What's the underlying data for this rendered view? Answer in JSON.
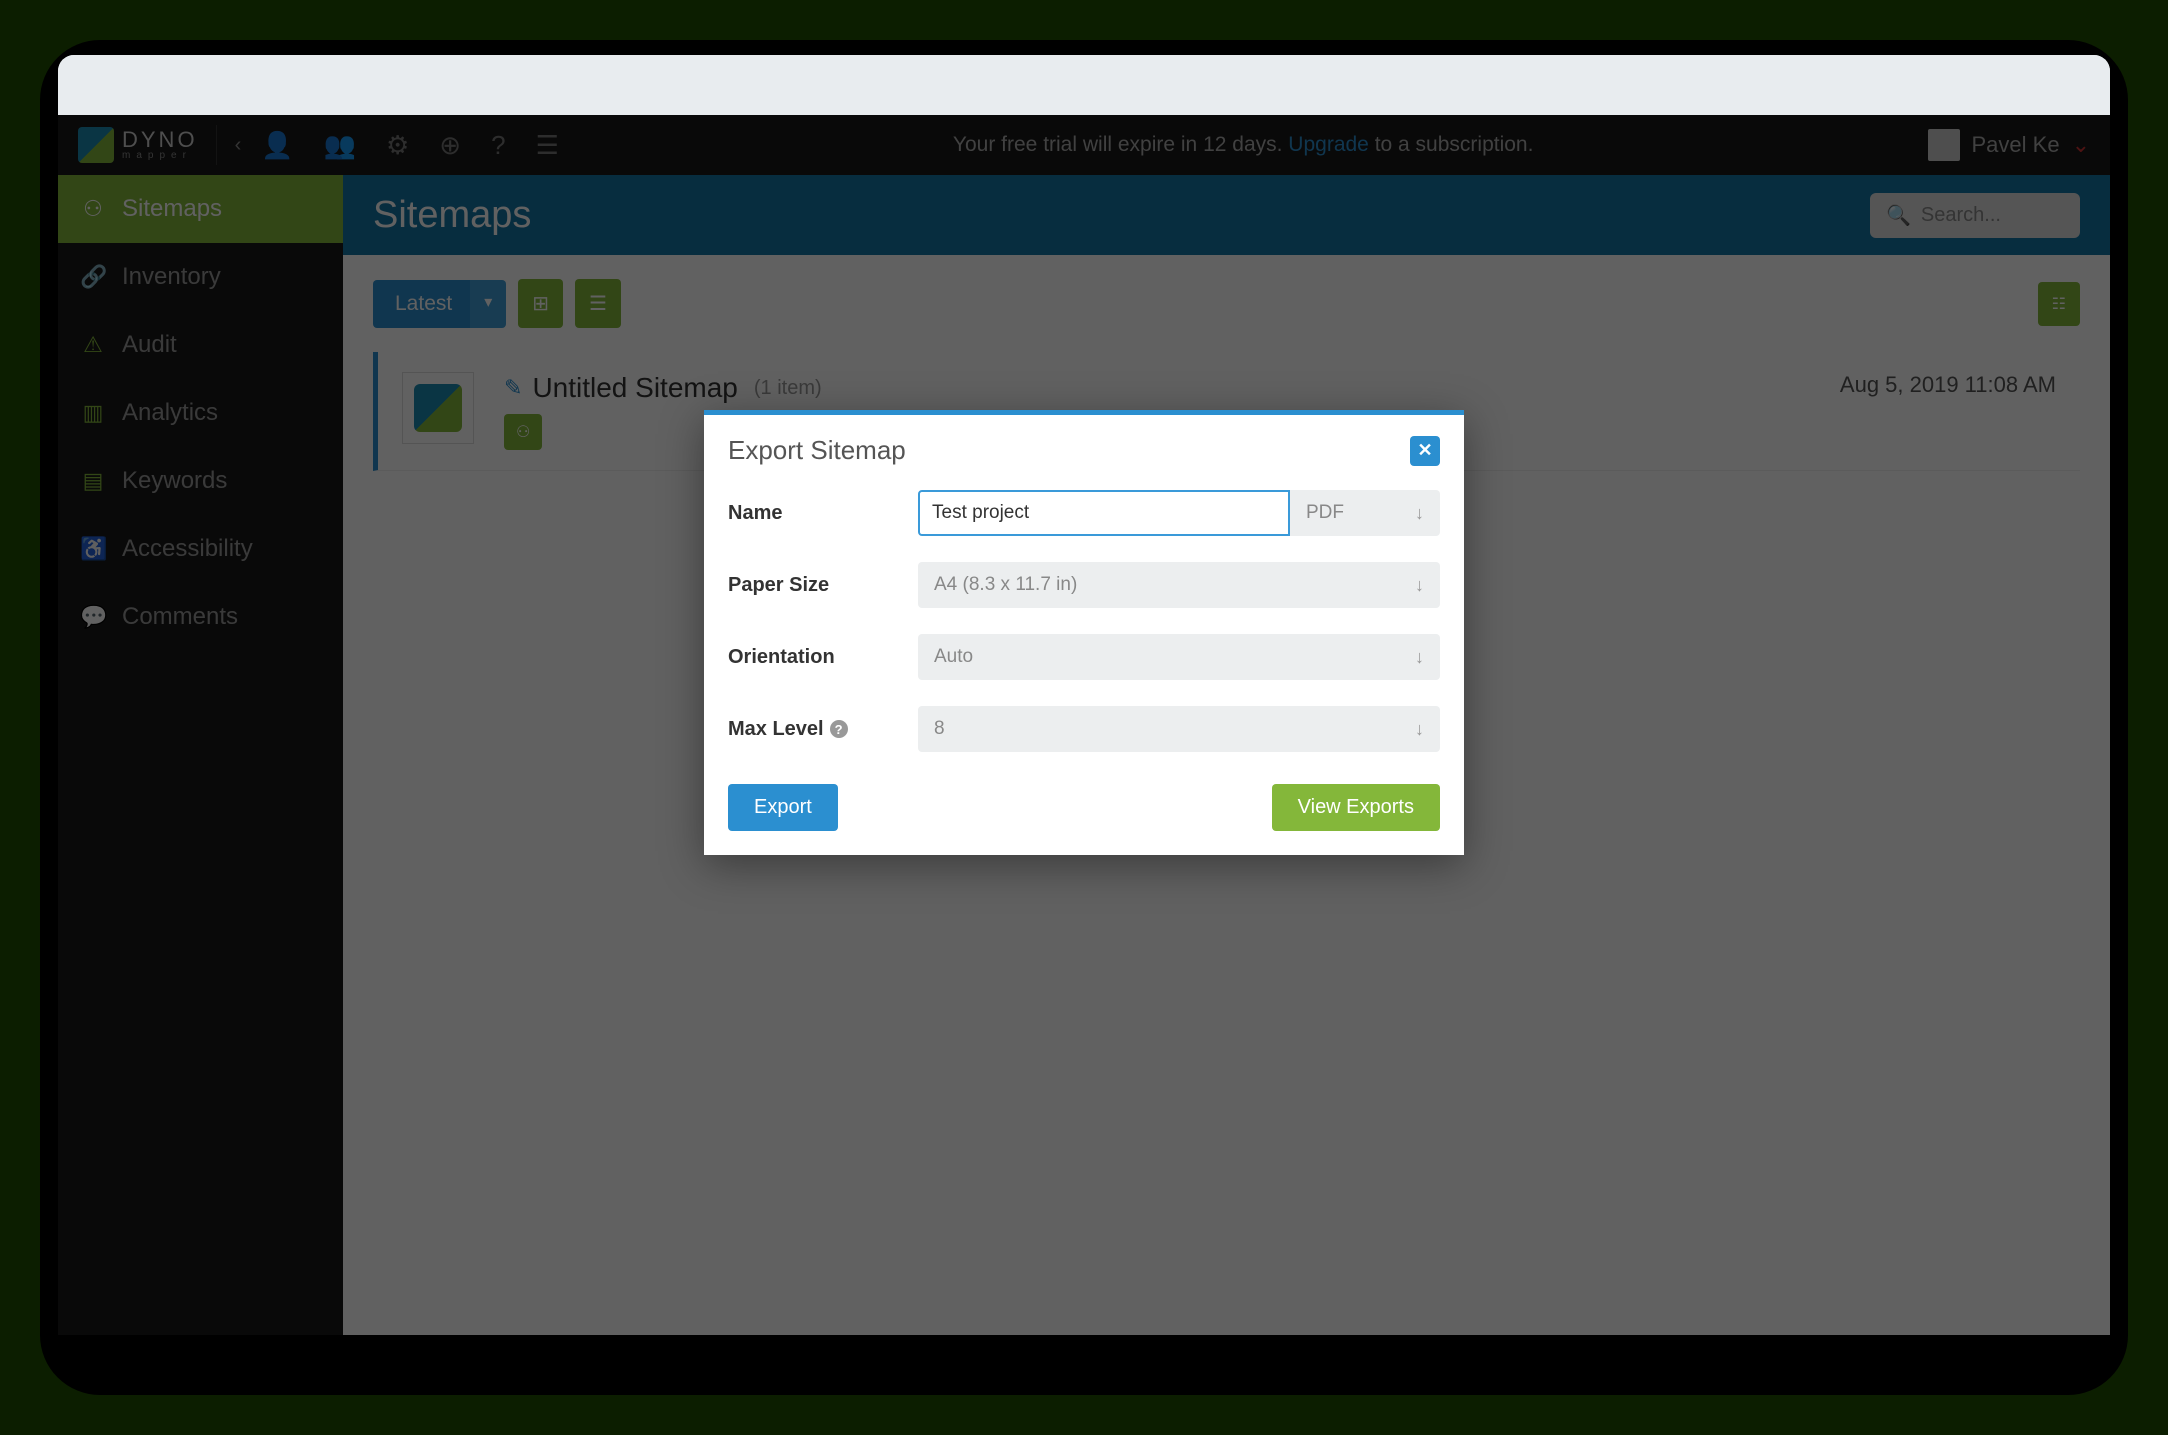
{
  "app_name": "DYNO",
  "app_subname": "mapper",
  "trial": {
    "prefix": "Your free trial will expire in 12 days. ",
    "link": "Upgrade",
    "suffix": " to a subscription."
  },
  "user": {
    "name": "Pavel Ke"
  },
  "sidebar": {
    "items": [
      {
        "label": "Sitemaps",
        "icon": "sitemap"
      },
      {
        "label": "Inventory",
        "icon": "link"
      },
      {
        "label": "Audit",
        "icon": "warning"
      },
      {
        "label": "Analytics",
        "icon": "chart"
      },
      {
        "label": "Keywords",
        "icon": "list"
      },
      {
        "label": "Accessibility",
        "icon": "access"
      },
      {
        "label": "Comments",
        "icon": "comment"
      }
    ]
  },
  "page": {
    "title": "Sitemaps",
    "search_placeholder": "Search...",
    "filter_label": "Latest"
  },
  "sitemap": {
    "title": "Untitled Sitemap",
    "sub": "(1 item)",
    "date": "Aug 5, 2019 11:08 AM"
  },
  "modal": {
    "title": "Export Sitemap",
    "fields": {
      "name_label": "Name",
      "name_value": "Test project",
      "format_value": "PDF",
      "papersize_label": "Paper Size",
      "papersize_value": "A4 (8.3 x 11.7 in)",
      "orientation_label": "Orientation",
      "orientation_value": "Auto",
      "maxlevel_label": "Max Level",
      "maxlevel_value": "8"
    },
    "export_btn": "Export",
    "view_exports_btn": "View Exports"
  }
}
